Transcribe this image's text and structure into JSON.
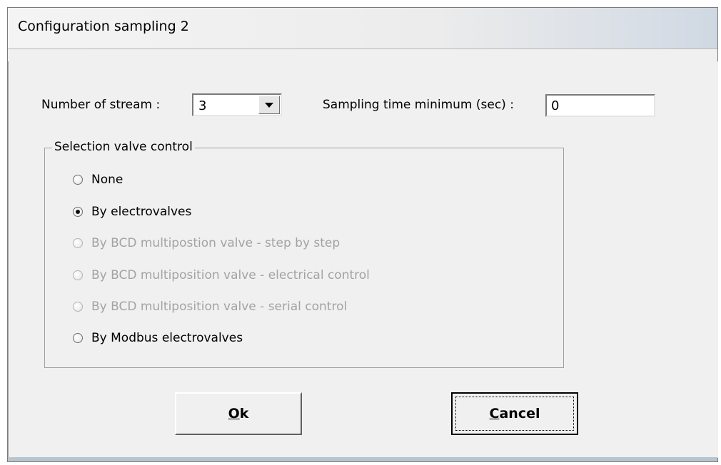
{
  "window": {
    "title": "Configuration sampling 2"
  },
  "form": {
    "stream_label": "Number of stream :",
    "stream_value": "3",
    "sampling_label": "Sampling time minimum (sec) :",
    "sampling_value": "0"
  },
  "selection_group": {
    "title": "Selection valve control",
    "options": [
      {
        "label": "None",
        "checked": false,
        "enabled": true
      },
      {
        "label": "By electrovalves",
        "checked": true,
        "enabled": true
      },
      {
        "label": "By BCD multipostion valve - step by step",
        "checked": false,
        "enabled": false
      },
      {
        "label": "By BCD multiposition valve - electrical control",
        "checked": false,
        "enabled": false
      },
      {
        "label": "By BCD multiposition valve - serial control",
        "checked": false,
        "enabled": false
      },
      {
        "label": "By Modbus electrovalves",
        "checked": false,
        "enabled": true
      }
    ]
  },
  "buttons": {
    "ok_accel": "O",
    "ok_rest": "k",
    "cancel_accel": "C",
    "cancel_rest": "ancel"
  },
  "icons": {
    "dropdown": "chevron-down-icon"
  }
}
